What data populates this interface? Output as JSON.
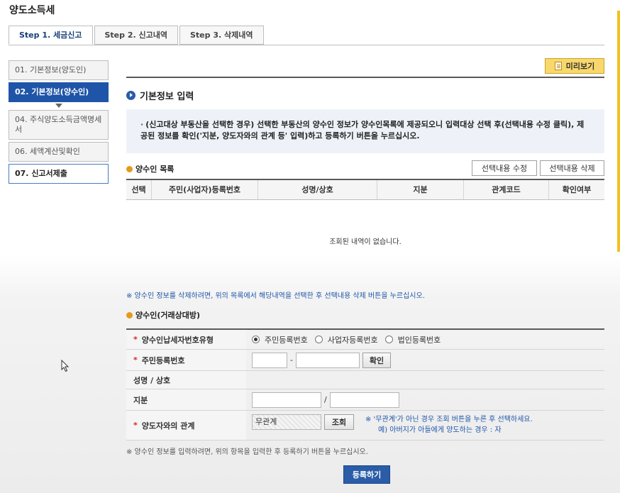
{
  "page_title": "양도소득세",
  "tabs": [
    {
      "label": "Step 1. 세금신고"
    },
    {
      "label": "Step 2. 신고내역"
    },
    {
      "label": "Step 3. 삭제내역"
    }
  ],
  "steps": [
    {
      "label": "01. 기본정보(양도인)"
    },
    {
      "label": "02. 기본정보(양수인)"
    },
    {
      "label": "04. 주식양도소득금액명세서"
    },
    {
      "label": "06. 세액계산및확인"
    },
    {
      "label": "07. 신고서제출"
    }
  ],
  "preview_label": "미리보기",
  "section_title": "기본정보 입력",
  "notice": {
    "bullet": "·",
    "text": "(신고대상 부동산을 선택한 경우) 선택한 부동산의 양수인 정보가 양수인목록에 제공되오니 입력대상 선택 후(선택내용 수정 클릭), 제공된 정보를 확인('지분, 양도자와의 관계 등' 입력)하고 등록하기 버튼을 누르십시오."
  },
  "buyer_list": {
    "title": "양수인 목록",
    "edit_button": "선택내용 수정",
    "delete_button": "선택내용 삭제",
    "columns": [
      "선택",
      "주민(사업자)등록번호",
      "성명/상호",
      "지분",
      "관계코드",
      "확인여부"
    ],
    "empty_message": "조회된 내역이 없습니다."
  },
  "delete_note": "※ 양수인 정보를 삭제하려면, 위의 목록에서 해당내역을 선택한 후 선택내용 삭제 버튼을 누르십시오.",
  "buyer_form": {
    "title": "양수인(거래상대방)",
    "required_mark": "*",
    "rows": {
      "id_type_label": "양수인납세자번호유형",
      "id_type_options": [
        "주민등록번호",
        "사업자등록번호",
        "법인등록번호"
      ],
      "id_number_label": "주민등록번호",
      "id_separator": "-",
      "confirm_button": "확인",
      "name_label": "성명 / 상호",
      "share_label": "지분",
      "share_separator": "/",
      "relation_label": "양도자와의 관계",
      "relation_value": "무관계",
      "lookup_button": "조회",
      "relation_note_1": "※ '무관계'가 아닌 경우 조회 버튼을 누른 후 선택하세요.",
      "relation_note_2": "예) 아버지가 아들에게 양도하는 경우 : 자"
    }
  },
  "input_note": "※ 양수인 정보를 입력하려면, 위의 항목을 입력한 후 등록하기 버튼을 누르십시오.",
  "register_button": "등록하기",
  "colors": {
    "accent_blue": "#1f55a8",
    "preview_yellow": "#f9d86b",
    "required_red": "#d22222",
    "bullet_orange": "#e59a1c"
  }
}
